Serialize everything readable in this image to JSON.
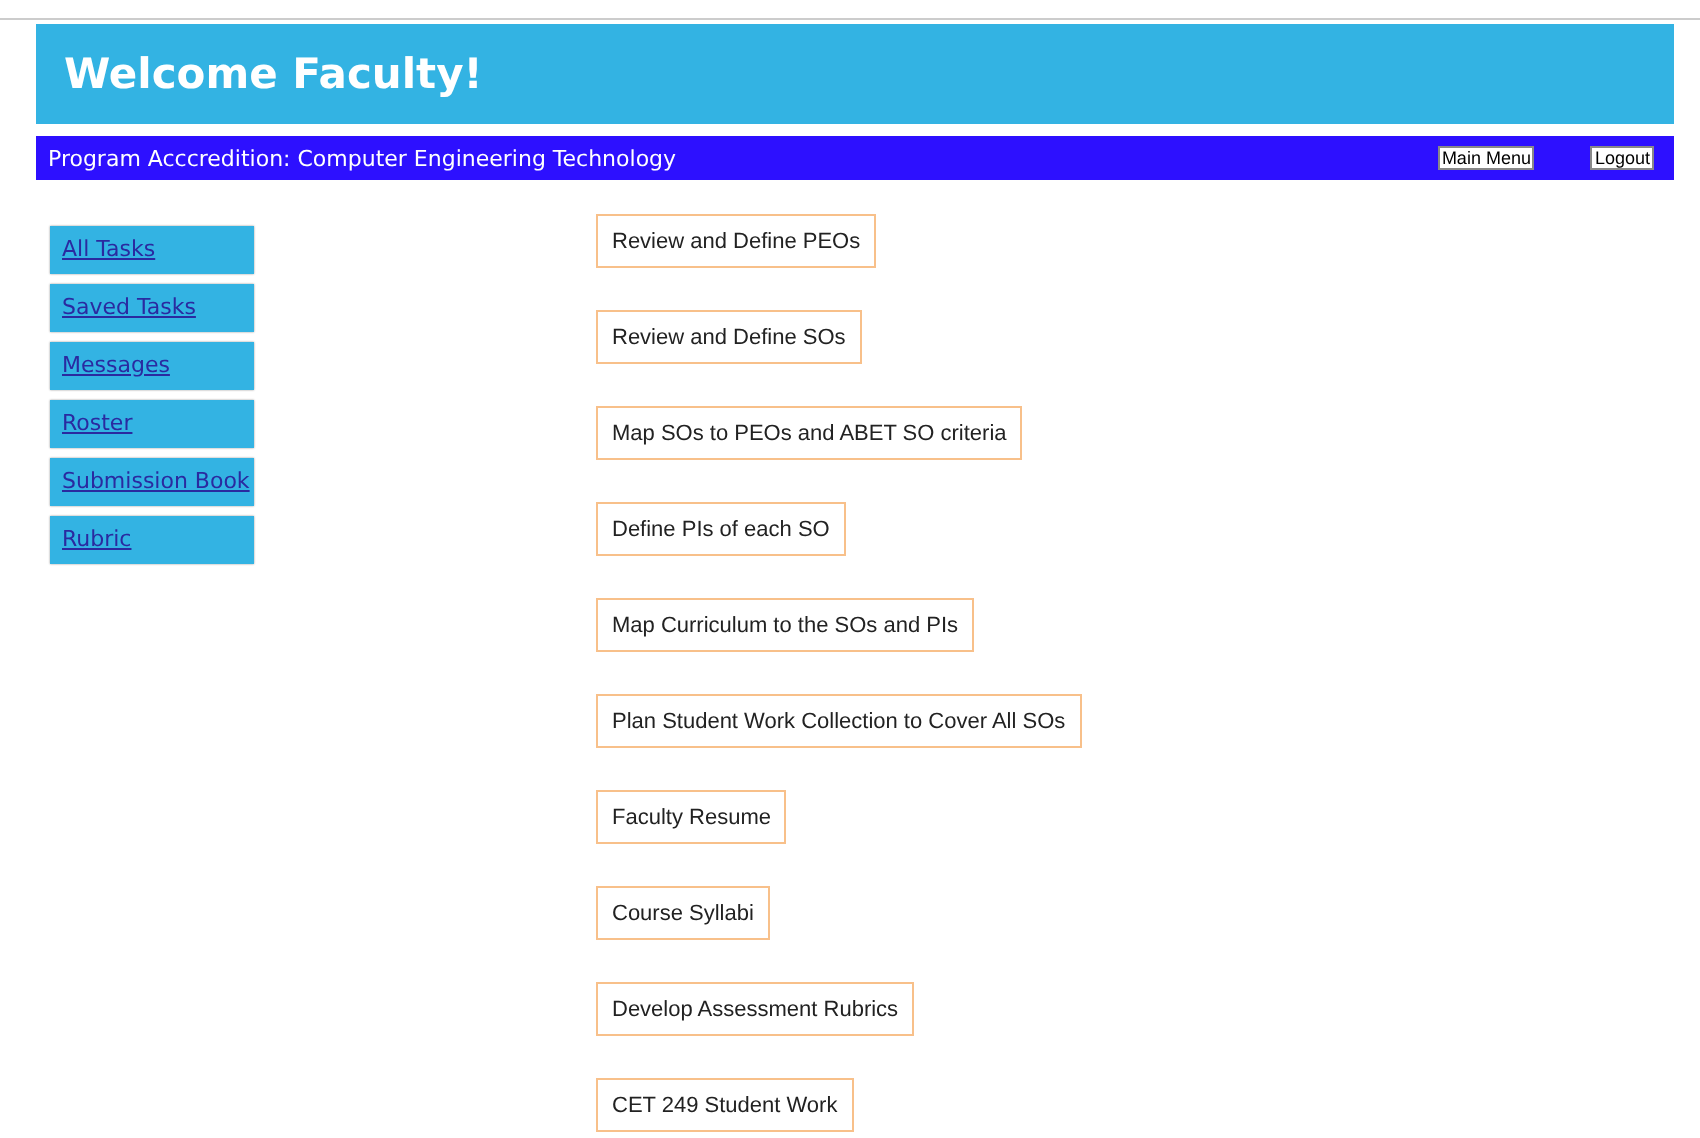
{
  "header": {
    "title": "Welcome Faculty!"
  },
  "navbar": {
    "program": "Program Acccredition: Computer Engineering Technology",
    "buttons": [
      "Main Menu",
      "Logout"
    ]
  },
  "sidebar": {
    "items": [
      "All Tasks",
      "Saved Tasks",
      "Messages",
      "Roster",
      "Submission Book",
      "Rubric"
    ]
  },
  "tasks": [
    "Review and Define PEOs",
    "Review and Define SOs",
    "Map SOs to PEOs and ABET SO criteria",
    "Define PIs of each SO",
    "Map Curriculum to the SOs and PIs",
    "Plan Student Work Collection to Cover All SOs",
    "Faculty Resume",
    "Course Syllabi",
    "Develop Assessment Rubrics",
    "CET 249 Student Work"
  ]
}
